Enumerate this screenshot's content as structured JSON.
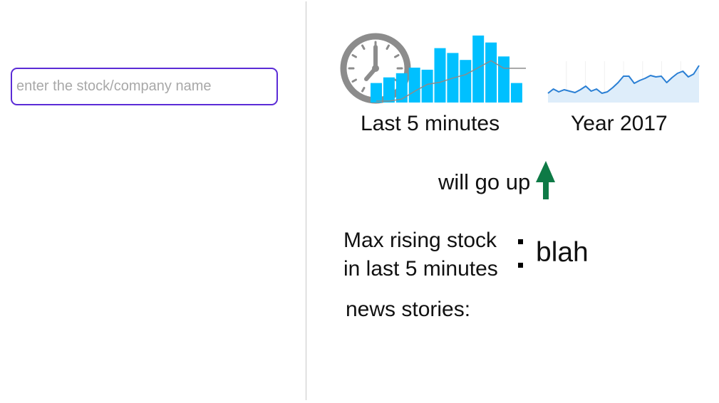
{
  "search": {
    "placeholder": "enter the stock/company name",
    "value": ""
  },
  "charts": {
    "recent": {
      "caption": "Last 5 minutes",
      "icon": "clock-icon",
      "bar_values": [
        28,
        36,
        42,
        50,
        47,
        78,
        71,
        61,
        96,
        86,
        66,
        28
      ],
      "line_values": [
        0,
        0,
        3,
        14,
        24,
        27,
        33,
        38,
        48,
        58,
        47,
        47
      ],
      "bar_color": "#00c0ff",
      "line_color": "#8c8c8c"
    },
    "year": {
      "caption": "Year 2017",
      "values": [
        13,
        19,
        15,
        18,
        16,
        14,
        18,
        23,
        16,
        19,
        13,
        15,
        21,
        28,
        37,
        37,
        27,
        31,
        34,
        38,
        36,
        37,
        28,
        35,
        41,
        44,
        36,
        40,
        52
      ],
      "line_color": "#2a7fd4",
      "fill_color": "#deedfa"
    }
  },
  "prediction": {
    "text": "will go up",
    "direction": "up",
    "color": "#0e7a46"
  },
  "max_rising": {
    "label_line1": "Max rising stock",
    "label_line2": "in last 5 minutes",
    "value": "blah"
  },
  "news": {
    "label": "news stories:"
  }
}
